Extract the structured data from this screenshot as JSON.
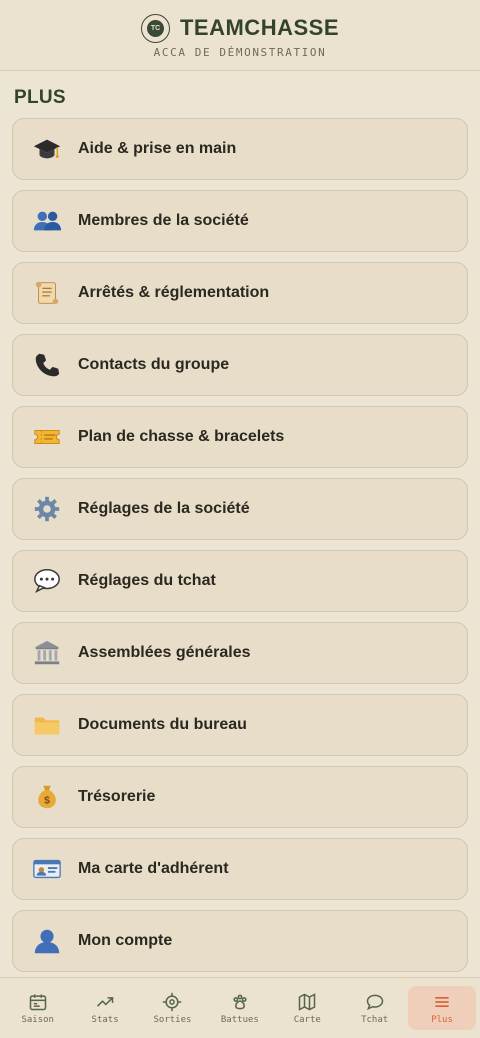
{
  "header": {
    "logo_text": "TC",
    "brand": "TEAMCHASSE",
    "subtitle": "ACCA DE DÉMONSTRATION"
  },
  "section": {
    "title": "PLUS"
  },
  "menu": [
    {
      "label": "Aide & prise en main",
      "icon": "graduation-cap-icon"
    },
    {
      "label": "Membres de la société",
      "icon": "users-icon"
    },
    {
      "label": "Arrêtés & réglementation",
      "icon": "scroll-icon"
    },
    {
      "label": "Contacts du groupe",
      "icon": "phone-icon"
    },
    {
      "label": "Plan de chasse & bracelets",
      "icon": "ticket-icon"
    },
    {
      "label": "Réglages de la société",
      "icon": "gear-icon"
    },
    {
      "label": "Réglages du tchat",
      "icon": "speech-bubble-icon"
    },
    {
      "label": "Assemblées générales",
      "icon": "classical-building-icon"
    },
    {
      "label": "Documents du bureau",
      "icon": "folder-icon"
    },
    {
      "label": "Trésorerie",
      "icon": "money-bag-icon"
    },
    {
      "label": "Ma carte d'adhérent",
      "icon": "id-card-icon"
    },
    {
      "label": "Mon compte",
      "icon": "user-icon"
    }
  ],
  "nav": [
    {
      "label": "Saison",
      "icon": "calendar-icon",
      "active": false
    },
    {
      "label": "Stats",
      "icon": "trend-up-icon",
      "active": false
    },
    {
      "label": "Sorties",
      "icon": "crosshair-icon",
      "active": false
    },
    {
      "label": "Battues",
      "icon": "paw-icon",
      "active": false
    },
    {
      "label": "Carte",
      "icon": "map-icon",
      "active": false
    },
    {
      "label": "Tchat",
      "icon": "chat-icon",
      "active": false
    },
    {
      "label": "Plus",
      "icon": "menu-icon",
      "active": true
    }
  ],
  "colors": {
    "background": "#ede5d4",
    "card": "#e8ddc9",
    "brand_green": "#33432f",
    "accent_orange": "#d9623a",
    "active_nav_bg": "#efcfb9"
  }
}
